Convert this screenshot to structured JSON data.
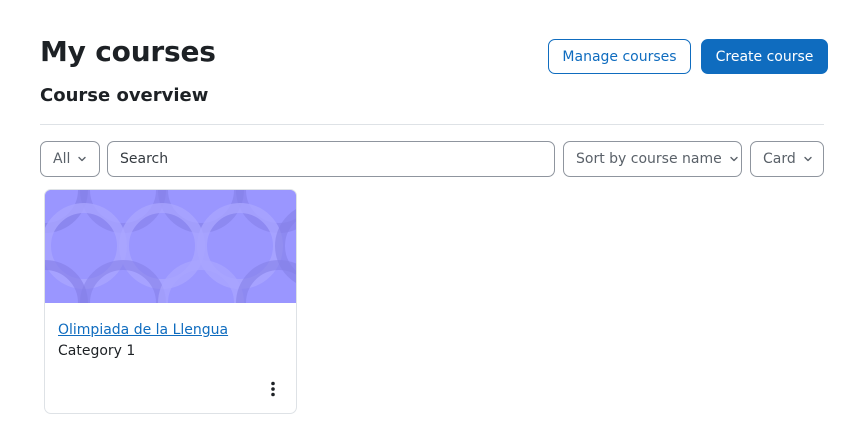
{
  "header": {
    "title": "My courses",
    "manage_label": "Manage courses",
    "create_label": "Create course"
  },
  "overview": {
    "title": "Course overview"
  },
  "filters": {
    "grouping_value": "All",
    "search_placeholder": "Search",
    "sort_value": "Sort by course name",
    "view_value": "Card"
  },
  "courses": [
    {
      "name": "Olimpiada de la Llengua",
      "category": "Category 1"
    }
  ],
  "colors": {
    "primary": "#0f6cbf",
    "card_pattern_bg": "#9a96ff",
    "text": "#1d2125",
    "border": "#8f959e"
  },
  "icons": {
    "dropdown": "chevron-down-icon",
    "card_menu": "more-vertical-icon"
  }
}
